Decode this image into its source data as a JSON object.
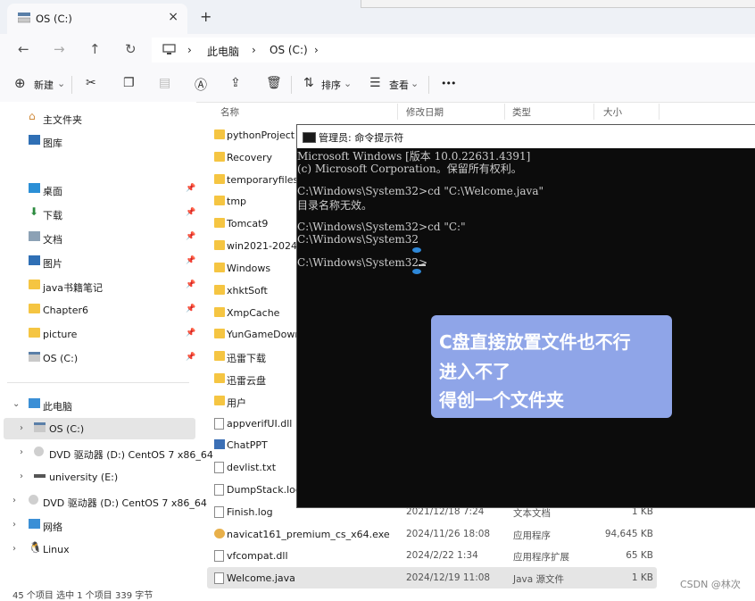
{
  "tab": {
    "title": "OS (C:)",
    "close": "×",
    "new_tab": "+"
  },
  "nav": {
    "back": "←",
    "forward": "→",
    "up": "↑",
    "refresh": "↻",
    "crumbs": [
      "此电脑",
      "OS (C:)"
    ],
    "sep": "›"
  },
  "toolbar": {
    "new_label": "新建",
    "sort_label": "排序",
    "view_label": "查看",
    "more": "•••"
  },
  "sidebar": {
    "home": "主文件夹",
    "gallery": "图库",
    "quick": [
      "桌面",
      "下载",
      "文档",
      "图片",
      "java书籍笔记",
      "Chapter6",
      "picture",
      "OS (C:)"
    ],
    "this_pc": "此电脑",
    "drives": [
      "OS (C:)",
      "DVD 驱动器 (D:) CentOS 7 x86_64",
      "university (E:)"
    ],
    "dvd_root": "DVD 驱动器 (D:) CentOS 7 x86_64",
    "network": "网络",
    "linux": "Linux"
  },
  "columns": {
    "name": "名称",
    "date": "修改日期",
    "type": "类型",
    "size": "大小"
  },
  "files": [
    {
      "name": "pythonProject",
      "date": "",
      "type": "",
      "size": ""
    },
    {
      "name": "Recovery",
      "date": "",
      "type": "",
      "size": ""
    },
    {
      "name": "temporaryfiles",
      "date": "",
      "type": "",
      "size": ""
    },
    {
      "name": "tmp",
      "date": "",
      "type": "",
      "size": ""
    },
    {
      "name": "Tomcat9",
      "date": "",
      "type": "",
      "size": ""
    },
    {
      "name": "win2021-2024",
      "date": "",
      "type": "",
      "size": ""
    },
    {
      "name": "Windows",
      "date": "",
      "type": "",
      "size": ""
    },
    {
      "name": "xhktSoft",
      "date": "",
      "type": "",
      "size": ""
    },
    {
      "name": "XmpCache",
      "date": "",
      "type": "",
      "size": ""
    },
    {
      "name": "YunGameDownl",
      "date": "",
      "type": "",
      "size": ""
    },
    {
      "name": "迅雷下载",
      "date": "",
      "type": "",
      "size": ""
    },
    {
      "name": "迅雷云盘",
      "date": "",
      "type": "",
      "size": ""
    },
    {
      "name": "用户",
      "date": "",
      "type": "",
      "size": ""
    },
    {
      "name": "appverifUI.dll",
      "date": "",
      "type": "",
      "size": ""
    },
    {
      "name": "ChatPPT",
      "date": "",
      "type": "",
      "size": ""
    },
    {
      "name": "devlist.txt",
      "date": "",
      "type": "",
      "size": ""
    },
    {
      "name": "DumpStack.log",
      "date": "",
      "type": "",
      "size": ""
    },
    {
      "name": "Finish.log",
      "date": "2021/12/18 7:24",
      "type": "文本文档",
      "size": "1 KB"
    },
    {
      "name": "navicat161_premium_cs_x64.exe",
      "date": "2024/11/26 18:08",
      "type": "应用程序",
      "size": "94,645 KB"
    },
    {
      "name": "vfcompat.dll",
      "date": "2024/2/22 1:34",
      "type": "应用程序扩展",
      "size": "65 KB"
    },
    {
      "name": "Welcome.java",
      "date": "2024/12/19 11:08",
      "type": "Java 源文件",
      "size": "1 KB"
    }
  ],
  "status": "45 个项目    选中 1 个项目  339 字节",
  "cmd": {
    "title": "管理员: 命令提示符",
    "lines": [
      "Microsoft Windows [版本 10.0.22631.4391]",
      "(c) Microsoft Corporation。保留所有权利。",
      "",
      "C:\\Windows\\System32>cd \"C:\\Welcome.java\"",
      "目录名称无效。",
      "",
      "C:\\Windows\\System32>cd \"C:\"",
      "C:\\Windows\\System32",
      "",
      "C:\\Windows\\System32>"
    ]
  },
  "callout": [
    "C盘直接放置文件也不行",
    "进入不了",
    "得创一个文件夹"
  ],
  "watermark": "CSDN @林次",
  "colors": {
    "folder": "#f5c542",
    "selected_row": "#e5e5e5",
    "callout": "#8fa5e8",
    "cmd_bg": "#0c0c0c"
  }
}
